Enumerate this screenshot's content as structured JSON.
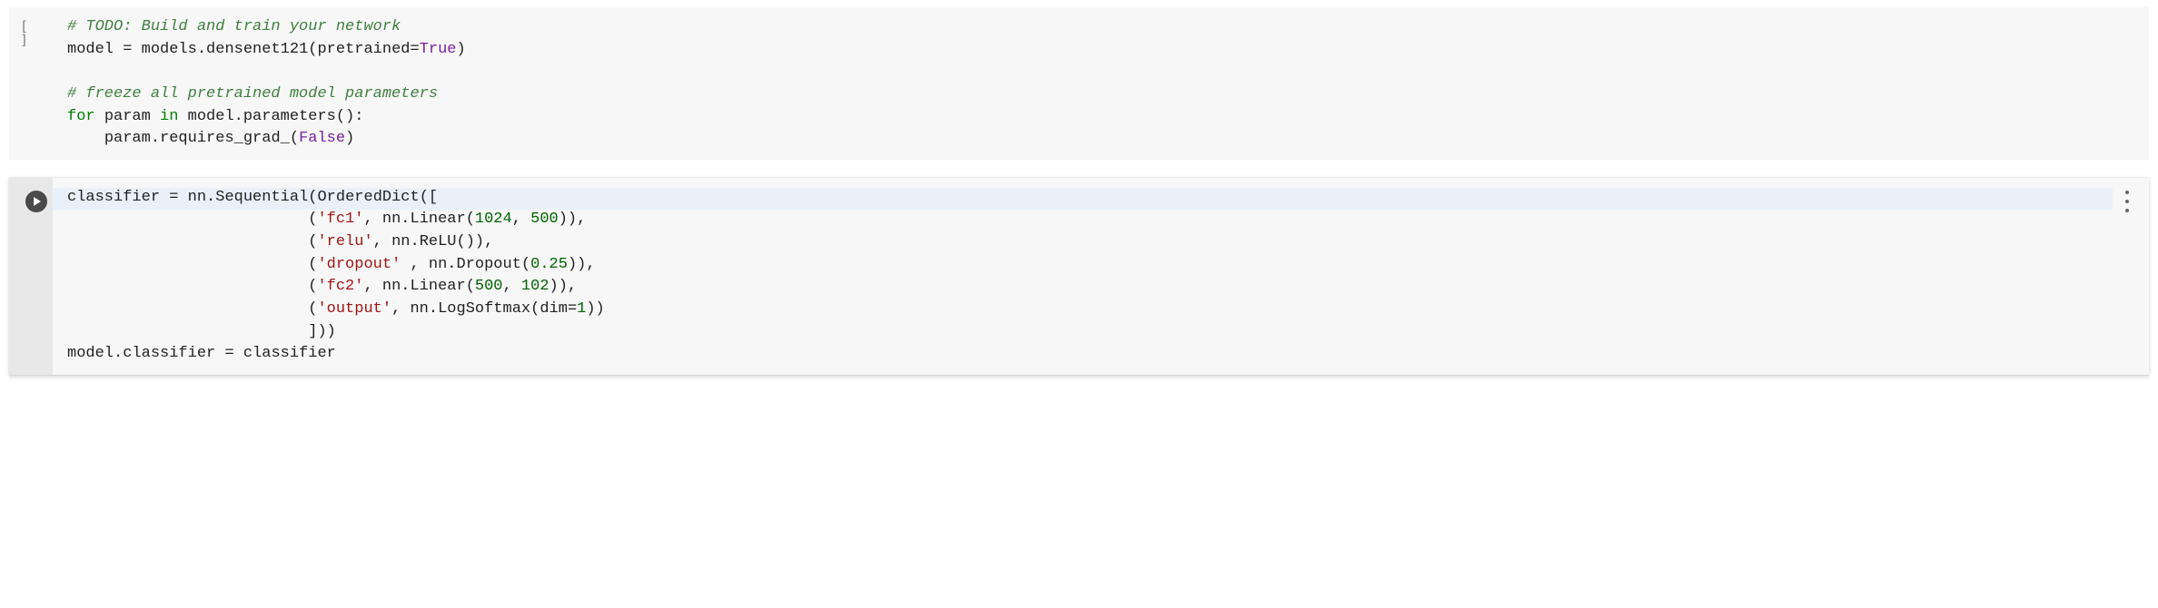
{
  "cell1": {
    "line1": "# TODO: Build and train your network",
    "line2": {
      "model": "model",
      "eq": " = ",
      "models": "models",
      "dot": ".",
      "func": "densenet121",
      "open": "(",
      "kw": "pretrained",
      "eq2": "=",
      "true": "True",
      "close": ")"
    },
    "line3_blank": "",
    "line4": "# freeze all pretrained model parameters",
    "line5": {
      "for": "for",
      "sp": " ",
      "param": "param",
      "in": " in ",
      "model": "model",
      "dot": ".",
      "parameters": "parameters",
      "parens": "():",
      "full_in": "in"
    },
    "line6": {
      "indent": "    ",
      "param": "param",
      "dot": ".",
      "req": "requires_grad_",
      "open": "(",
      "false": "False",
      "close": ")"
    }
  },
  "cell2": {
    "indent": "                          ",
    "line1": {
      "classifier": "classifier",
      "eq": " = ",
      "nn": "nn",
      "dot": ".",
      "seq": "Sequential",
      "open": "(",
      "od": "OrderedDict",
      "open2": "(["
    },
    "line2": {
      "open": "(",
      "key": "'fc1'",
      "comma": ", ",
      "nn": "nn",
      "dot": ".",
      "lin": "Linear",
      "op": "(",
      "n1": "1024",
      "c2": ", ",
      "n2": "500",
      "close": ")),"
    },
    "line3": {
      "open": "(",
      "key": "'relu'",
      "comma": ", ",
      "nn": "nn",
      "dot": ".",
      "relu": "ReLU",
      "parens": "()),"
    },
    "line4": {
      "open": "(",
      "key": "'dropout'",
      "sp": " ",
      "comma": ", ",
      "nn": "nn",
      "dot": ".",
      "drop": "Dropout",
      "op": "(",
      "n": "0.25",
      "close": ")),"
    },
    "line5": {
      "open": "(",
      "key": "'fc2'",
      "comma": ", ",
      "nn": "nn",
      "dot": ".",
      "lin": "Linear",
      "op": "(",
      "n1": "500",
      "c2": ", ",
      "n2": "102",
      "close": ")),"
    },
    "line6": {
      "open": "(",
      "key": "'output'",
      "comma": ", ",
      "nn": "nn",
      "dot": ".",
      "ls": "LogSoftmax",
      "op": "(",
      "dim": "dim",
      "eq": "=",
      "n": "1",
      "close": "))"
    },
    "line7": {
      "close": "]))"
    },
    "line8": {
      "model": "model",
      "dot": ".",
      "classifier": "classifier",
      "eq": " = ",
      "rhs": "classifier"
    }
  },
  "gutter": {
    "bracket": "[ ]"
  }
}
